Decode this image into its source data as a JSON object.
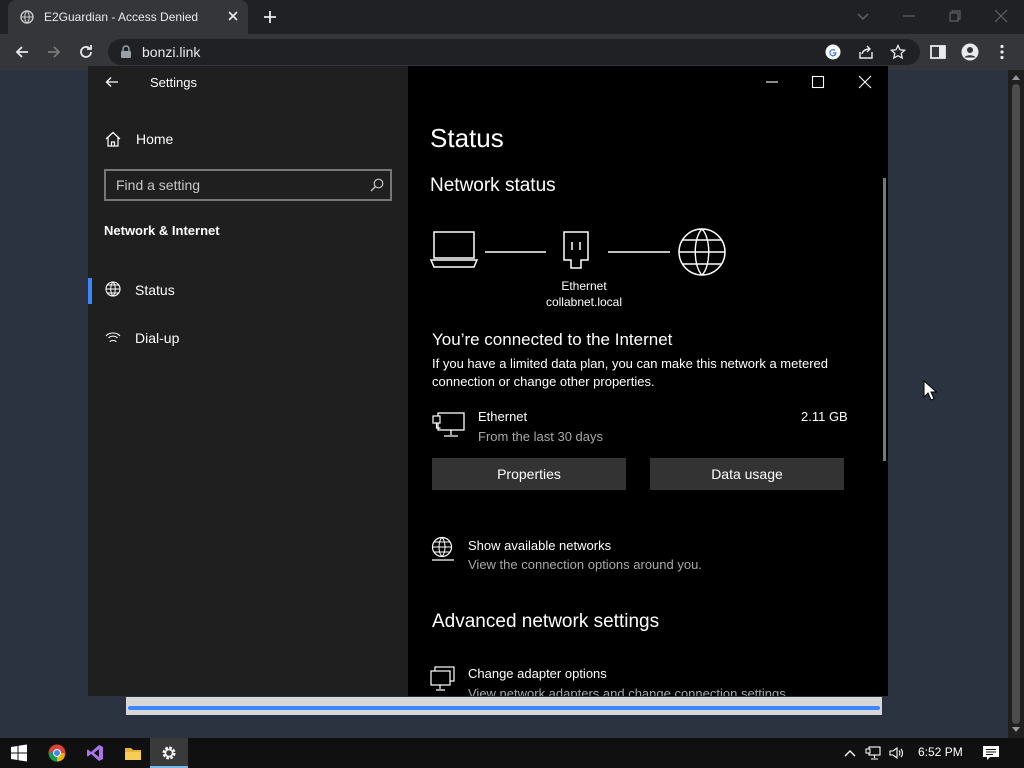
{
  "browser": {
    "tab_title": "E2Guardian - Access Denied",
    "url": "bonzi.link"
  },
  "settings": {
    "app_title": "Settings",
    "home_label": "Home",
    "search_placeholder": "Find a setting",
    "section_title": "Network & Internet",
    "nav": [
      {
        "label": "Status",
        "selected": true,
        "icon": "globe-icon"
      },
      {
        "label": "Dial-up",
        "selected": false,
        "icon": "dialup-icon"
      }
    ],
    "page_title": "Status",
    "network_status_heading": "Network status",
    "diagram": {
      "adapter_name": "Ethernet",
      "domain": "collabnet.local"
    },
    "connected_text": "You’re connected to the Internet",
    "description": "If you have a limited data plan, you can make this network a metered connection or change other properties.",
    "adapter": {
      "name": "Ethernet",
      "subtitle": "From the last 30 days",
      "usage": "2.11 GB"
    },
    "buttons": {
      "properties": "Properties",
      "data_usage": "Data usage"
    },
    "available_networks": {
      "title": "Show available networks",
      "subtitle": "View the connection options around you."
    },
    "advanced_heading": "Advanced network settings",
    "change_adapter": {
      "title": "Change adapter options",
      "subtitle": "View network adapters and change connection settings."
    }
  },
  "taskbar": {
    "clock": "6:52 PM"
  },
  "colors": {
    "accent": "#3c86ff",
    "settings_left_bg": "#1f1f1f",
    "settings_right_bg": "#000000",
    "page_bg": "#2b3340",
    "chrome_bg": "#202124"
  }
}
